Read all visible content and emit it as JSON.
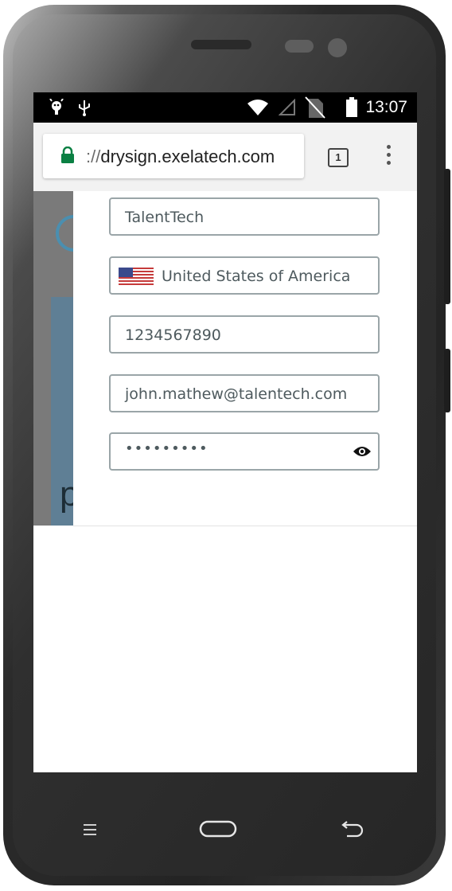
{
  "status_bar": {
    "time": "13:07",
    "icons": [
      "android-debug-icon",
      "usb-icon",
      "wifi-icon",
      "signal-icon",
      "no-sim-icon",
      "battery-icon"
    ]
  },
  "browser": {
    "url_prefix": "://",
    "url_host": "drysign.exelatech.com",
    "tab_count": "1",
    "lock_color": "#0b8043"
  },
  "form": {
    "company": "TalentTech",
    "country": "United States of America",
    "phone": "1234567890",
    "email": "john.mathew@talentech.com",
    "password_mask": "•••••••••"
  },
  "nav": {
    "icons": [
      "menu-icon",
      "home-icon",
      "back-icon"
    ]
  }
}
